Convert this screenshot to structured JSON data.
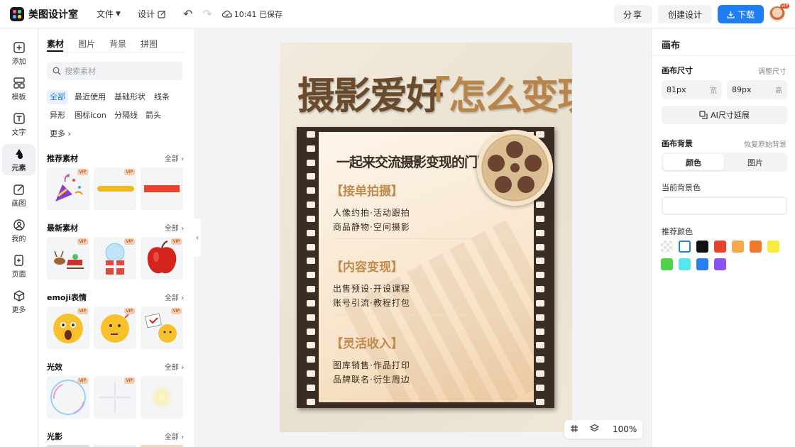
{
  "app": {
    "name": "美图设计室"
  },
  "topbar": {
    "file_menu": "文件",
    "design_menu": "设计",
    "saved_status": "10:41 已保存",
    "share_label": "分享",
    "create_label": "创建设计",
    "download_label": "下载",
    "avatar_badge": "VIP"
  },
  "rail": {
    "items": [
      {
        "label": "添加",
        "icon": "plus-square-icon"
      },
      {
        "label": "模板",
        "icon": "template-icon"
      },
      {
        "label": "文字",
        "icon": "text-icon"
      },
      {
        "label": "元素",
        "icon": "shapes-icon",
        "active": true
      },
      {
        "label": "画图",
        "icon": "pen-icon"
      },
      {
        "label": "我的",
        "icon": "user-icon"
      },
      {
        "label": "页面",
        "icon": "add-page-icon"
      },
      {
        "label": "更多",
        "icon": "cube-icon"
      }
    ]
  },
  "panel": {
    "tabs": [
      "素材",
      "图片",
      "背景",
      "拼图"
    ],
    "search_placeholder": "搜索素材",
    "chips": [
      "全部",
      "最近使用",
      "基础形状",
      "线条",
      "异形",
      "图标icon",
      "分隔线",
      "箭头"
    ],
    "more_label": "更多",
    "sections": [
      {
        "title": "推荐素材",
        "more": "全部"
      },
      {
        "title": "最新素材",
        "more": "全部"
      },
      {
        "title": "emoji表情",
        "more": "全部"
      },
      {
        "title": "光效",
        "more": "全部"
      },
      {
        "title": "光影",
        "more": "全部"
      }
    ],
    "vip_badge": "VIP"
  },
  "canvas": {
    "title_left": "摄影爱好",
    "title_right": "「怎么变现」",
    "subtitle": "一起来交流摄影变现的门路",
    "blocks": [
      {
        "heading": "【接单拍摄】",
        "lines": [
          "人像约拍·活动跟拍",
          "商品静物·空间摄影"
        ]
      },
      {
        "heading": "【内容变现】",
        "lines": [
          "出售预设·开设课程",
          "账号引流·教程打包"
        ]
      },
      {
        "heading": "【灵活收入】",
        "lines": [
          "图库销售·作品打印",
          "品牌联名·衍生周边"
        ]
      }
    ]
  },
  "zoom": {
    "level": "100%"
  },
  "rpanel": {
    "title": "画布",
    "size_label": "画布尺寸",
    "size_link": "调整尺寸",
    "width_value": "81px",
    "width_unit": "宽",
    "height_value": "89px",
    "height_unit": "高",
    "ai_button": "AI尺寸延展",
    "bg_label": "画布背景",
    "bg_reset": "恢复原始背景",
    "seg_color": "颜色",
    "seg_image": "图片",
    "current_bg_label": "当前背景色",
    "recommend_label": "推荐颜色",
    "swatches": [
      "transparent",
      "#ffffff",
      "#111111",
      "#e9412b",
      "#f5a94b",
      "#ef7a2a",
      "#f7ec3a",
      "#52d14a",
      "#55e6ee",
      "#2a7ef2",
      "#8a52f0"
    ]
  }
}
